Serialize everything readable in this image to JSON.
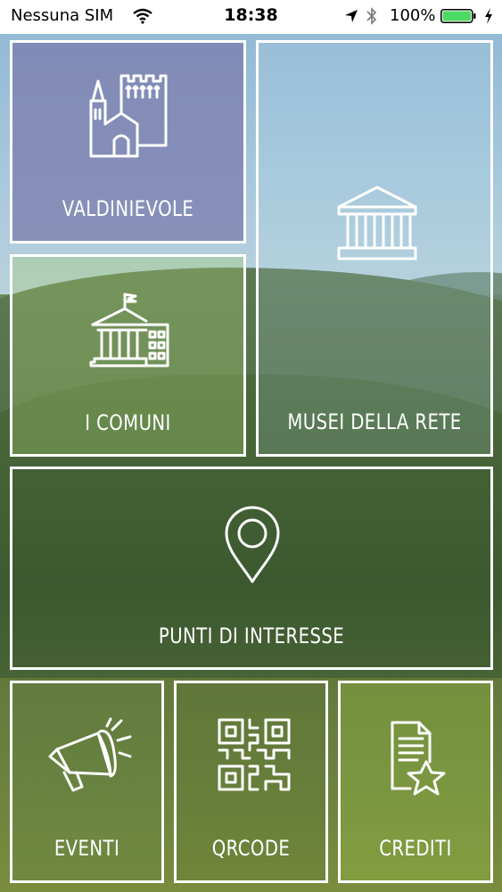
{
  "status_bar": {
    "carrier": "Nessuna SIM",
    "time": "18:38",
    "battery_percent": "100%",
    "battery_color": "#4cd964"
  },
  "tiles": {
    "valdinievole": {
      "label": "VALDINIEVOLE",
      "icon": "castle-icon",
      "color": "#7878aa"
    },
    "comuni": {
      "label": "I COMUNI",
      "icon": "town-hall-icon",
      "color": "#a0c86e"
    },
    "musei": {
      "label": "MUSEI DELLA RETE",
      "icon": "museum-icon",
      "color": "#aad2e6"
    },
    "punti": {
      "label": "PUNTI DI INTERESSE",
      "icon": "map-pin-icon"
    },
    "eventi": {
      "label": "EVENTI",
      "icon": "megaphone-icon"
    },
    "qrcode": {
      "label": "QRCODE",
      "icon": "qrcode-icon"
    },
    "crediti": {
      "label": "CREDITI",
      "icon": "document-star-icon"
    }
  }
}
